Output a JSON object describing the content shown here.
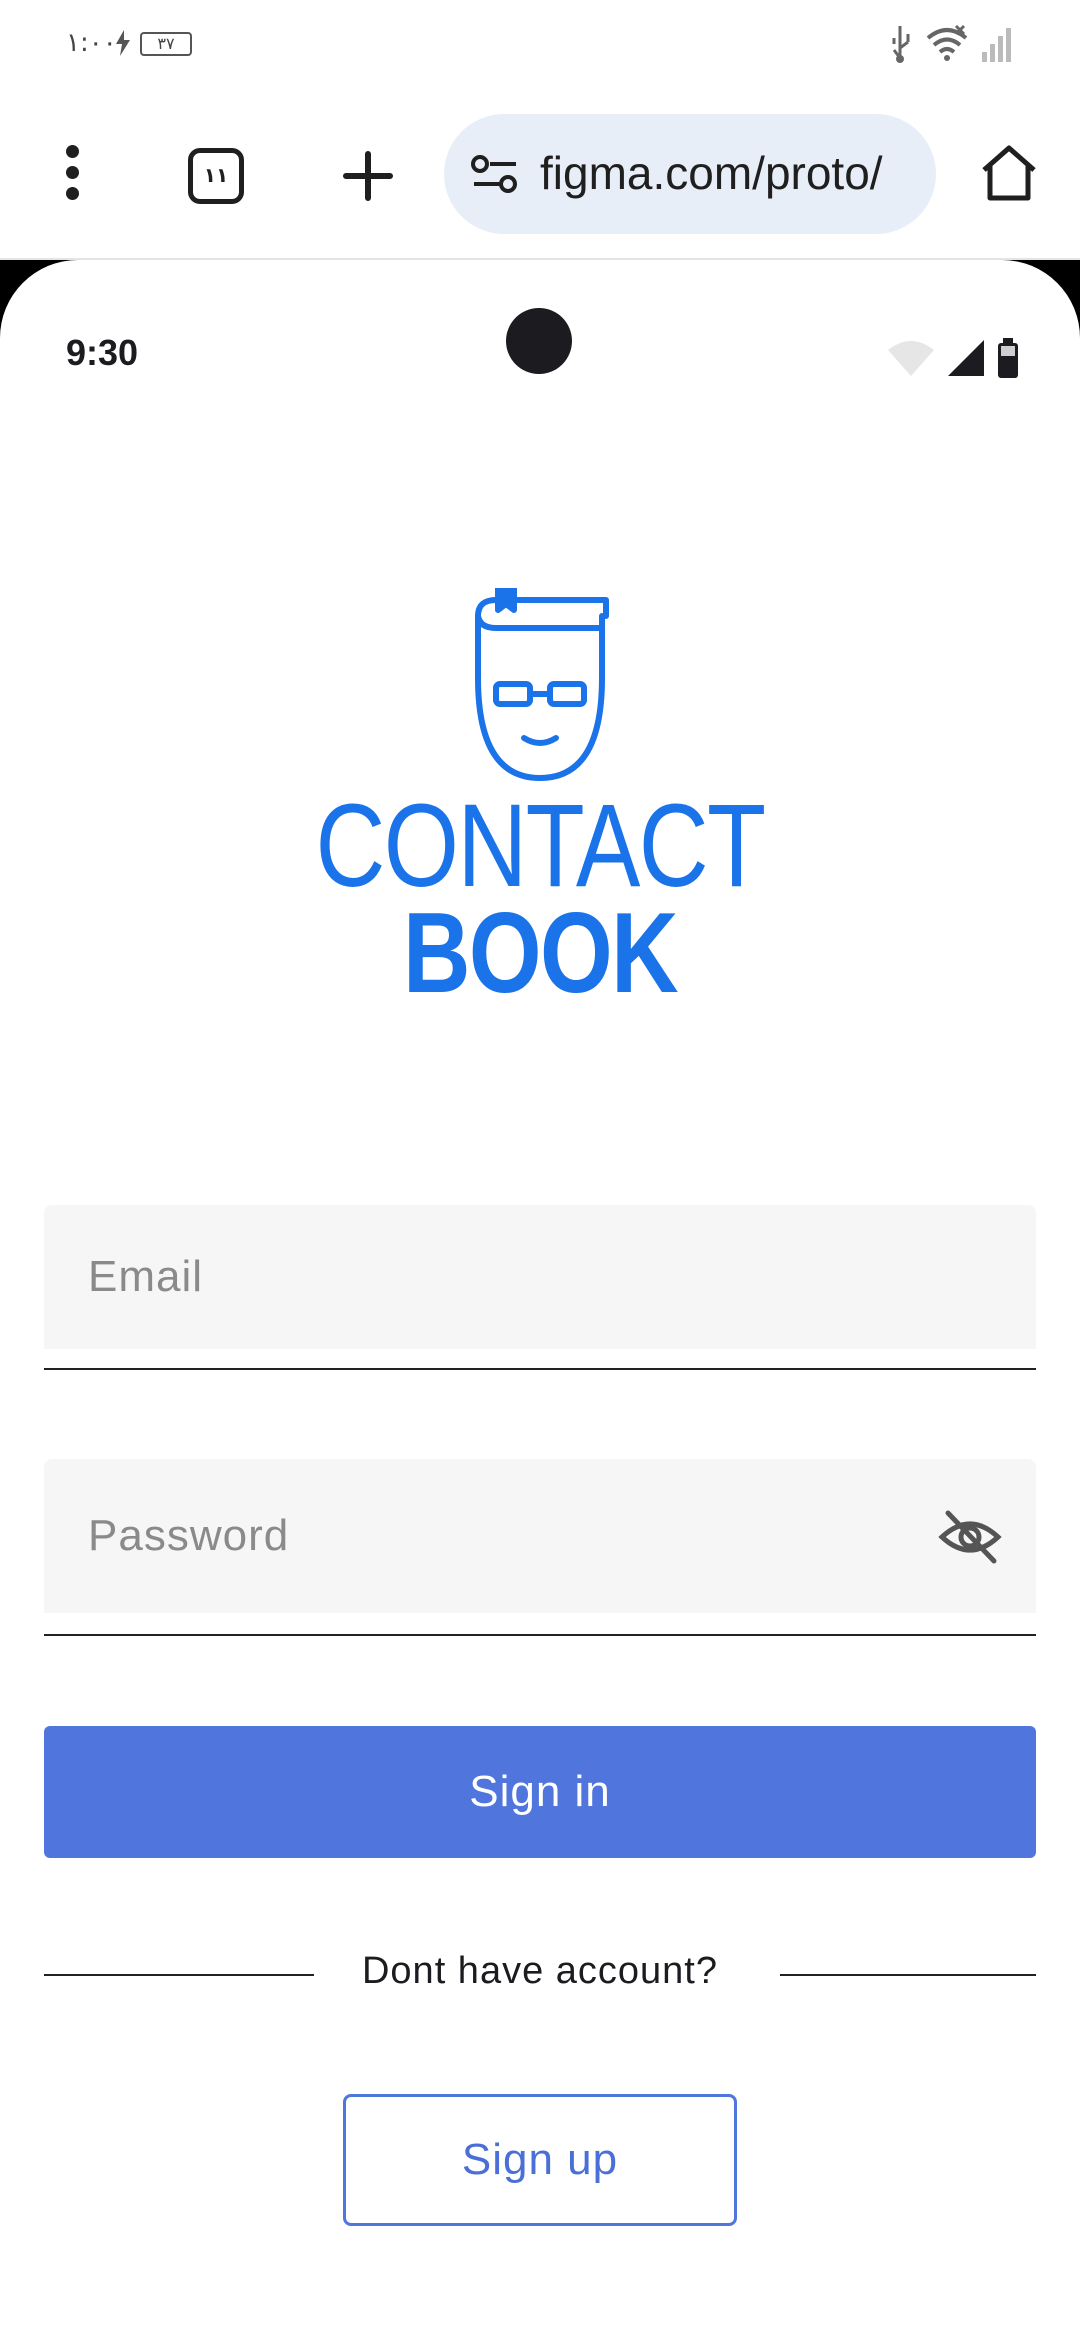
{
  "system_status": {
    "time": "١:٠٠",
    "battery_level": "٣٧"
  },
  "browser": {
    "tab_count": "١١",
    "url": "figma.com/proto/",
    "icons": [
      "menu-icon",
      "tabs-icon",
      "new-tab-icon",
      "site-settings-icon",
      "home-icon"
    ]
  },
  "phone": {
    "status_time": "9:30"
  },
  "logo": {
    "line1": "CONTACT",
    "line2": "BOOK",
    "accent_color": "#1a73e8"
  },
  "form": {
    "email_placeholder": "Email",
    "email_value": "",
    "password_placeholder": "Password",
    "password_value": "",
    "signin_label": "Sign in",
    "divider_text": "Dont have account?",
    "signup_label": "Sign up",
    "primary_color": "#5076dd"
  }
}
